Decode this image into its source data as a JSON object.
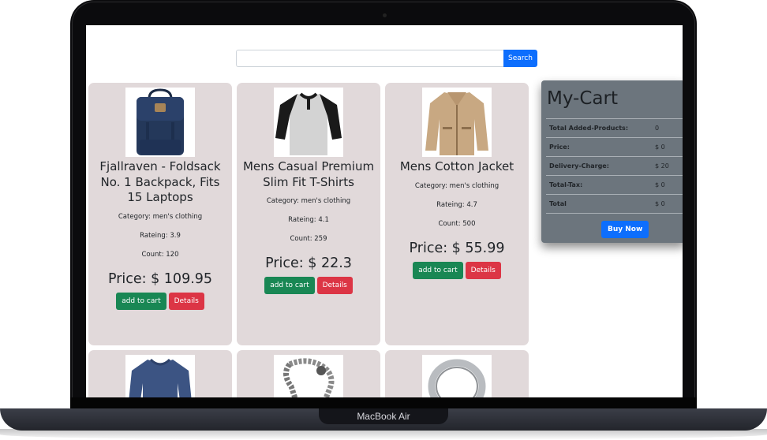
{
  "device": {
    "brand": "MacBook Air"
  },
  "search": {
    "placeholder": "",
    "value": "",
    "button_label": "Search"
  },
  "products": [
    {
      "title": "Fjallraven - Foldsack No. 1 Backpack, Fits 15 Laptops",
      "category": "Category: men's clothing",
      "rating": "Rateing: 3.9",
      "count": "Count: 120",
      "price": "Price: $ 109.95",
      "image_icon": "backpack-icon"
    },
    {
      "title": "Mens Casual Premium Slim Fit T-Shirts",
      "category": "Category: men's clothing",
      "rating": "Rateing: 4.1",
      "count": "Count: 259",
      "price": "Price: $ 22.3",
      "image_icon": "tshirt-icon"
    },
    {
      "title": "Mens Cotton Jacket",
      "category": "Category: men's clothing",
      "rating": "Rateing: 4.7",
      "count": "Count: 500",
      "price": "Price: $ 55.99",
      "image_icon": "jacket-icon"
    },
    {
      "image_icon": "sweater-icon"
    },
    {
      "image_icon": "bracelet-icon"
    },
    {
      "image_icon": "ring-icon"
    }
  ],
  "buttons": {
    "add_to_cart": "add to cart",
    "details": "Details"
  },
  "cart": {
    "title": "My-Cart",
    "rows": [
      {
        "label": "Total Added-Products:",
        "value": "0"
      },
      {
        "label": "Price:",
        "value": "$ 0"
      },
      {
        "label": "Delivery-Charge:",
        "value": "$ 20"
      },
      {
        "label": "Total-Tax:",
        "value": "$ 0"
      },
      {
        "label": "Total",
        "value": "$ 0"
      }
    ],
    "buy_label": "Buy Now"
  },
  "colors": {
    "card_bg": "#e1d9da",
    "cart_bg": "#6c757d",
    "primary": "#0d6efd",
    "success": "#198754",
    "danger": "#dc3545"
  }
}
